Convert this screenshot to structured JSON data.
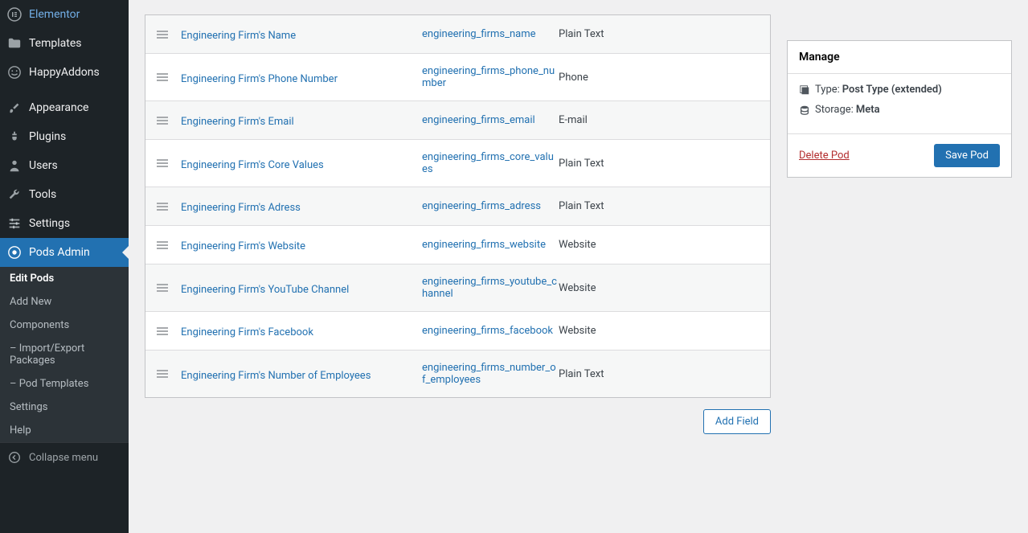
{
  "sidebar": {
    "items": [
      {
        "label": "Elementor"
      },
      {
        "label": "Templates"
      },
      {
        "label": "HappyAddons"
      },
      {
        "label": "Appearance"
      },
      {
        "label": "Plugins"
      },
      {
        "label": "Users"
      },
      {
        "label": "Tools"
      },
      {
        "label": "Settings"
      },
      {
        "label": "Pods Admin"
      }
    ],
    "submenu": [
      {
        "label": "Edit Pods"
      },
      {
        "label": "Add New"
      },
      {
        "label": "Components"
      },
      {
        "label": "– Import/Export Packages"
      },
      {
        "label": "– Pod Templates"
      },
      {
        "label": "Settings"
      },
      {
        "label": "Help"
      }
    ],
    "collapse": "Collapse menu"
  },
  "fields": [
    {
      "label": "Engineering Firm's Name",
      "name": "engineering_firms_name",
      "type": "Plain Text"
    },
    {
      "label": "Engineering Firm's Phone Number",
      "name": "engineering_firms_phone_number",
      "type": "Phone"
    },
    {
      "label": "Engineering Firm's Email",
      "name": "engineering_firms_email",
      "type": "E-mail"
    },
    {
      "label": "Engineering Firm's Core Values",
      "name": "engineering_firms_core_values",
      "type": "Plain Text"
    },
    {
      "label": "Engineering Firm's Adress",
      "name": "engineering_firms_adress",
      "type": "Plain Text"
    },
    {
      "label": "Engineering Firm's Website",
      "name": "engineering_firms_website",
      "type": "Website"
    },
    {
      "label": "Engineering Firm's YouTube Channel",
      "name": "engineering_firms_youtube_channel",
      "type": "Website"
    },
    {
      "label": "Engineering Firm's Facebook",
      "name": "engineering_firms_facebook",
      "type": "Website"
    },
    {
      "label": "Engineering Firm's Number of Employees",
      "name": "engineering_firms_number_of_employees",
      "type": "Plain Text"
    }
  ],
  "buttons": {
    "add_field": "Add Field",
    "save_pod": "Save Pod",
    "delete_pod": "Delete Pod"
  },
  "panel": {
    "manage_title": "Manage",
    "type_label": "Type: ",
    "type_value": "Post Type (extended)",
    "storage_label": "Storage: ",
    "storage_value": "Meta"
  }
}
